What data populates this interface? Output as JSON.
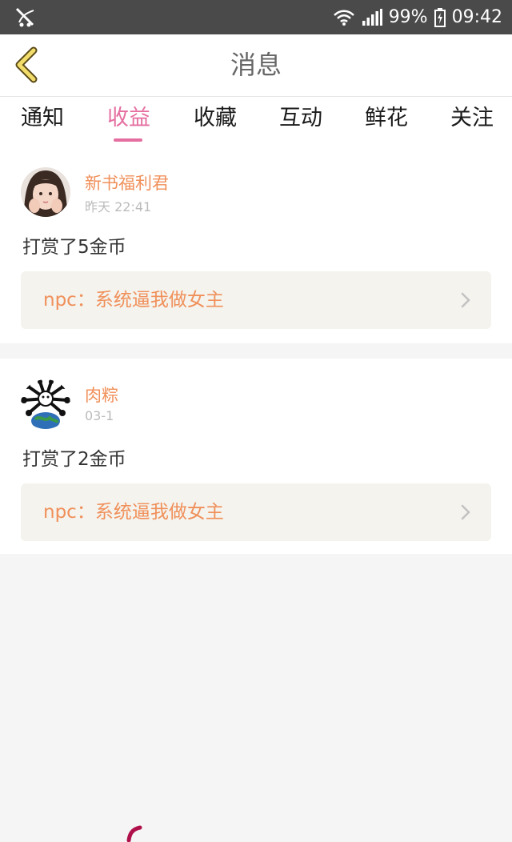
{
  "status_bar": {
    "battery": "99%",
    "time": "09:42",
    "icons": [
      "app-notification-icon",
      "wifi-icon",
      "signal-icon",
      "battery-icon"
    ]
  },
  "header": {
    "title": "消息",
    "back_icon": "chevron-left-icon"
  },
  "tabs": [
    {
      "label": "通知",
      "active": false
    },
    {
      "label": "收益",
      "active": true
    },
    {
      "label": "收藏",
      "active": false
    },
    {
      "label": "互动",
      "active": false
    },
    {
      "label": "鲜花",
      "active": false
    },
    {
      "label": "关注",
      "active": false
    }
  ],
  "messages": [
    {
      "username": "新书福利君",
      "time": "昨天 22:41",
      "text": "打赏了5金币",
      "book_link": "npc：系统逼我做女主"
    },
    {
      "username": "肉粽",
      "time": "03-1",
      "text": "打赏了2金币",
      "book_link": "npc：系统逼我做女主"
    }
  ],
  "colors": {
    "accent": "#e56ea0",
    "username": "#f0905a",
    "status_bar": "#4a4a4a"
  }
}
